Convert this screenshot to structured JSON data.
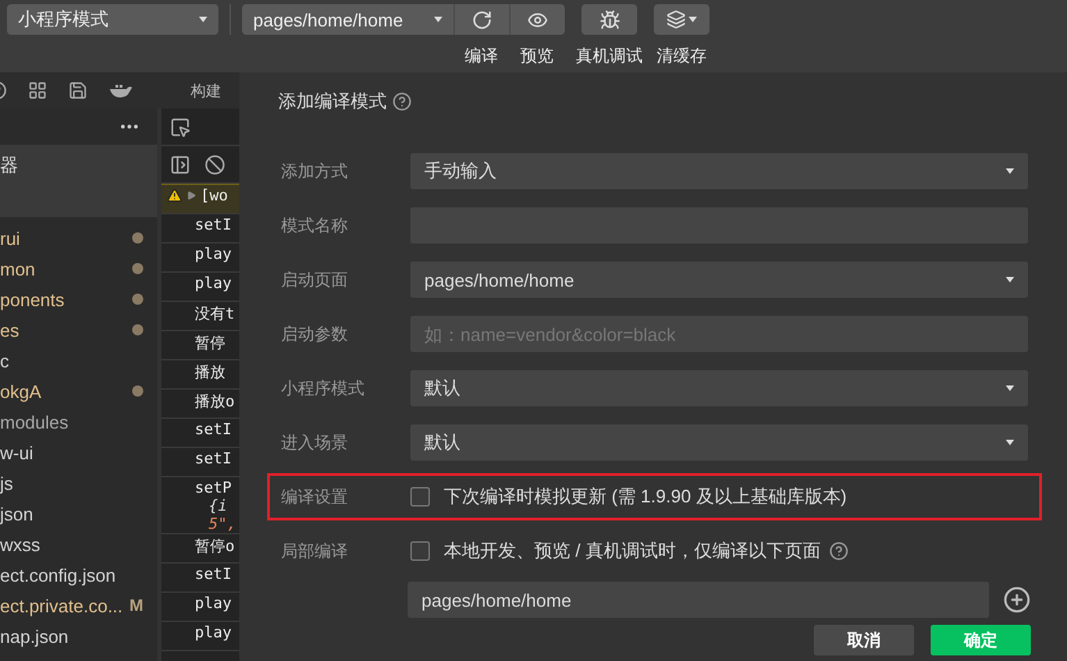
{
  "toolbar": {
    "mode_select": "小程序模式",
    "page_select": "pages/home/home",
    "tools": [
      {
        "kind": "compile",
        "label": "编译"
      },
      {
        "kind": "preview",
        "label": "预览"
      },
      {
        "kind": "debug",
        "label": "真机调试"
      },
      {
        "kind": "cache",
        "label": "清缓存"
      }
    ]
  },
  "side_strip": {
    "label": "构建"
  },
  "file_tree": {
    "root": "器",
    "items": [
      {
        "name": "rui",
        "color": "#e2c08d",
        "dot": true
      },
      {
        "name": "mon",
        "color": "#e2c08d",
        "dot": true
      },
      {
        "name": "ponents",
        "color": "#e2c08d",
        "dot": true
      },
      {
        "name": "es",
        "color": "#e2c08d",
        "dot": true
      },
      {
        "name": "c",
        "color": "#d4d4d4",
        "dot": false
      },
      {
        "name": "okgA",
        "color": "#e2c08d",
        "dot": true
      },
      {
        "name": "modules",
        "color": "#a8a8a8",
        "dot": false
      },
      {
        "name": "w-ui",
        "color": "#d4d4d4",
        "dot": false
      },
      {
        "name": "js",
        "color": "#d4d4d4",
        "dot": false
      },
      {
        "name": "json",
        "color": "#d4d4d4",
        "dot": false
      },
      {
        "name": "wxss",
        "color": "#d4d4d4",
        "dot": false
      },
      {
        "name": "ect.config.json",
        "color": "#d4d4d4",
        "dot": false
      },
      {
        "name": "ect.private.co...",
        "color": "#e2c08d",
        "dot": false,
        "badge": "M"
      },
      {
        "name": "nap.json",
        "color": "#d4d4d4",
        "dot": false
      }
    ]
  },
  "console": {
    "rows": [
      {
        "kind": "warning",
        "text": "[wo"
      },
      {
        "kind": "log",
        "text": "setI"
      },
      {
        "kind": "log",
        "text": "play"
      },
      {
        "kind": "log",
        "text": "play"
      },
      {
        "kind": "log",
        "text": "没有t"
      },
      {
        "kind": "log",
        "text": "暂停"
      },
      {
        "kind": "log",
        "text": "播放"
      },
      {
        "kind": "log",
        "text": "播放o"
      },
      {
        "kind": "log",
        "text": "setI"
      },
      {
        "kind": "log",
        "text": "setI"
      },
      {
        "kind": "object",
        "text": "setP",
        "detail": "{i",
        "value": "5\","
      },
      {
        "kind": "log",
        "text": "暂停o"
      },
      {
        "kind": "log",
        "text": "setI"
      },
      {
        "kind": "log",
        "text": "play"
      },
      {
        "kind": "log",
        "text": "play"
      }
    ]
  },
  "dialog": {
    "title": "添加编译模式",
    "fields": [
      {
        "label": "添加方式",
        "kind": "select",
        "value": "手动输入"
      },
      {
        "label": "模式名称",
        "kind": "input"
      },
      {
        "label": "启动页面",
        "kind": "select",
        "value": "pages/home/home"
      },
      {
        "label": "启动参数",
        "kind": "input",
        "placeholder": "如：name=vendor&color=black"
      },
      {
        "label": "小程序模式",
        "kind": "select",
        "value": "默认"
      },
      {
        "label": "进入场景",
        "kind": "select",
        "value": "默认"
      },
      {
        "label": "编译设置",
        "kind": "checkbox",
        "checked": false,
        "text": "下次编译时模拟更新 (需 1.9.90 及以上基础库版本)",
        "highlighted": true
      },
      {
        "label": "局部编译",
        "kind": "checkbox",
        "checked": false,
        "text": "本地开发、预览 / 真机调试时，仅编译以下页面",
        "help": true
      }
    ],
    "page_list": {
      "value": "pages/home/home"
    },
    "buttons": [
      {
        "label": "取消",
        "kind": "secondary"
      },
      {
        "label": "确定",
        "kind": "primary"
      }
    ]
  }
}
